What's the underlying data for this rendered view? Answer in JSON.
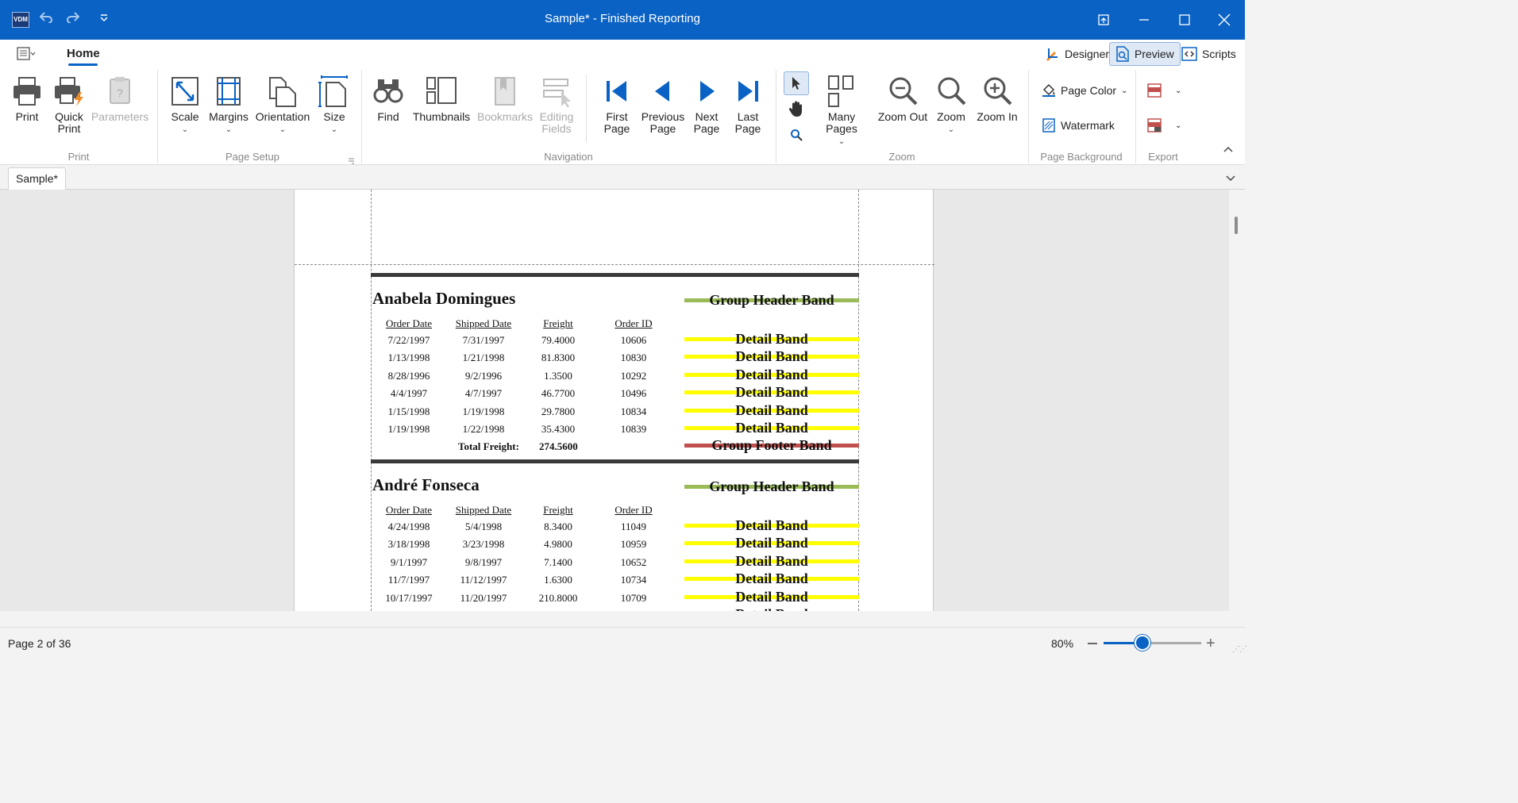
{
  "window": {
    "app_badge": "VDM",
    "title": "Sample* - Finished Reporting"
  },
  "tabs": {
    "home": "Home",
    "designer": "Designer",
    "preview": "Preview",
    "scripts": "Scripts"
  },
  "ribbon": {
    "print_group": {
      "label": "Print",
      "print": "Print",
      "quick_print_1": "Quick",
      "quick_print_2": "Print",
      "parameters": "Parameters"
    },
    "page_setup_group": {
      "label": "Page Setup",
      "scale": "Scale",
      "margins": "Margins",
      "orientation": "Orientation",
      "size": "Size"
    },
    "navigation_group": {
      "label": "Navigation",
      "find": "Find",
      "thumbnails": "Thumbnails",
      "bookmarks": "Bookmarks",
      "editing_fields_1": "Editing",
      "editing_fields_2": "Fields",
      "first_page_1": "First",
      "first_page_2": "Page",
      "previous_page_1": "Previous",
      "previous_page_2": "Page",
      "next_page_1": "Next",
      "next_page_2": "Page",
      "last_page_1": "Last",
      "last_page_2": "Page"
    },
    "zoom_group": {
      "label": "Zoom",
      "many_pages": "Many Pages",
      "zoom_out": "Zoom Out",
      "zoom": "Zoom",
      "zoom_in": "Zoom In"
    },
    "page_background_group": {
      "label": "Page Background",
      "page_color": "Page Color",
      "watermark": "Watermark"
    },
    "export_group": {
      "label": "Export"
    }
  },
  "document_tab": "Sample*",
  "report": {
    "columns": [
      "Order Date",
      "Shipped Date",
      "Freight",
      "Order ID"
    ],
    "group_header_band": "Group Header Band",
    "detail_band": "Detail Band",
    "group_footer_band": "Group Footer Band",
    "total_freight_label": "Total Freight:",
    "groups": [
      {
        "name": "Anabela Domingues",
        "rows": [
          [
            "7/22/1997",
            "7/31/1997",
            "79.4000",
            "10606"
          ],
          [
            "1/13/1998",
            "1/21/1998",
            "81.8300",
            "10830"
          ],
          [
            "8/28/1996",
            "9/2/1996",
            "1.3500",
            "10292"
          ],
          [
            "4/4/1997",
            "4/7/1997",
            "46.7700",
            "10496"
          ],
          [
            "1/15/1998",
            "1/19/1998",
            "29.7800",
            "10834"
          ],
          [
            "1/19/1998",
            "1/22/1998",
            "35.4300",
            "10839"
          ]
        ],
        "total_freight": "274.5600"
      },
      {
        "name": "André Fonseca",
        "rows": [
          [
            "4/24/1998",
            "5/4/1998",
            "8.3400",
            "11049"
          ],
          [
            "3/18/1998",
            "3/23/1998",
            "4.9800",
            "10959"
          ],
          [
            "9/1/1997",
            "9/8/1997",
            "7.1400",
            "10652"
          ],
          [
            "11/7/1997",
            "11/12/1997",
            "1.6300",
            "10734"
          ],
          [
            "10/17/1997",
            "11/20/1997",
            "210.8000",
            "10709"
          ]
        ]
      }
    ],
    "band_colors": {
      "group_header": "#9bbb59",
      "detail": "#ffff00",
      "group_footer": "#c0504d"
    }
  },
  "status": {
    "page_info": "Page 2 of 36",
    "zoom_percent": "80%"
  },
  "zoom_level": 0.4,
  "colors": {
    "accent": "#0a62c4"
  }
}
